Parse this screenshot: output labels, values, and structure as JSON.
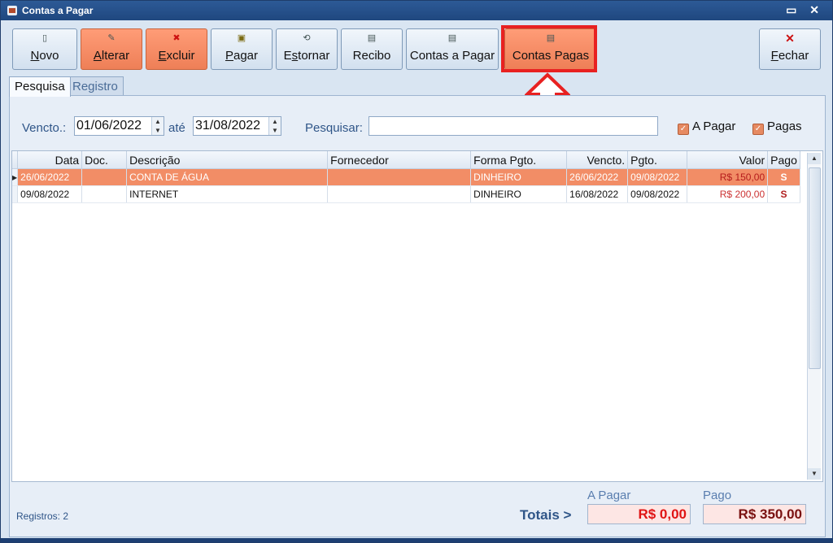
{
  "window": {
    "title": "Contas a Pagar",
    "controls": "▭ ✕"
  },
  "toolbar": {
    "buttons": [
      {
        "label": "Novo",
        "underline": "N",
        "icon": "new-document-icon",
        "style": "normal"
      },
      {
        "label": "Alterar",
        "underline": "A",
        "icon": "edit-icon",
        "style": "orange"
      },
      {
        "label": "Excluir",
        "underline": "E",
        "icon": "delete-icon",
        "style": "orange"
      },
      {
        "label": "Pagar",
        "underline": "P",
        "icon": "pay-icon",
        "style": "normal"
      },
      {
        "label": "Estornar",
        "underline": "s",
        "icon": "reverse-icon",
        "style": "normal"
      },
      {
        "label": "Recibo",
        "icon": "receipt-icon",
        "style": "normal"
      },
      {
        "label": "Contas a Pagar",
        "icon": "report-icon",
        "style": "normal"
      },
      {
        "label": "Contas Pagas",
        "icon": "report-icon",
        "style": "orange"
      },
      {
        "label": "Fechar",
        "underline": "F",
        "icon": "close-red-icon",
        "style": "normal"
      }
    ]
  },
  "tabs": [
    {
      "label": "Pesquisa",
      "active": true
    },
    {
      "label": "Registro",
      "active": false
    }
  ],
  "filter": {
    "vencto_label": "Vencto.:",
    "date_from": "01/06/2022",
    "ate_label": "até",
    "date_to": "31/08/2022",
    "pesquisar_label": "Pesquisar:",
    "search_value": "",
    "a_pagar_label": "A Pagar",
    "a_pagar_checked": true,
    "pagas_label": "Pagas",
    "pagas_checked": true
  },
  "grid": {
    "columns": [
      "Data",
      "Doc.",
      "Descrição",
      "Fornecedor",
      "Forma Pgto.",
      "Vencto.",
      "Pgto.",
      "Valor",
      "Pago"
    ],
    "rows": [
      {
        "selected": true,
        "cells": [
          "26/06/2022",
          "",
          "CONTA DE ÁGUA",
          "",
          "DINHEIRO",
          "26/06/2022",
          "09/08/2022",
          "R$ 150,00",
          "S"
        ]
      },
      {
        "selected": false,
        "cells": [
          "09/08/2022",
          "",
          "INTERNET",
          "",
          "DINHEIRO",
          "16/08/2022",
          "09/08/2022",
          "R$ 200,00",
          "S"
        ]
      }
    ]
  },
  "footer": {
    "registros": "Registros: 2",
    "totais_label": "Totais >",
    "a_pagar_label": "A Pagar",
    "a_pagar_value": "R$ 0,00",
    "pago_label": "Pago",
    "pago_value": "R$ 350,00"
  },
  "colors": {
    "accent_orange": "#f28d66",
    "highlight_red": "#e82121",
    "window_blue": "#1f477f"
  }
}
